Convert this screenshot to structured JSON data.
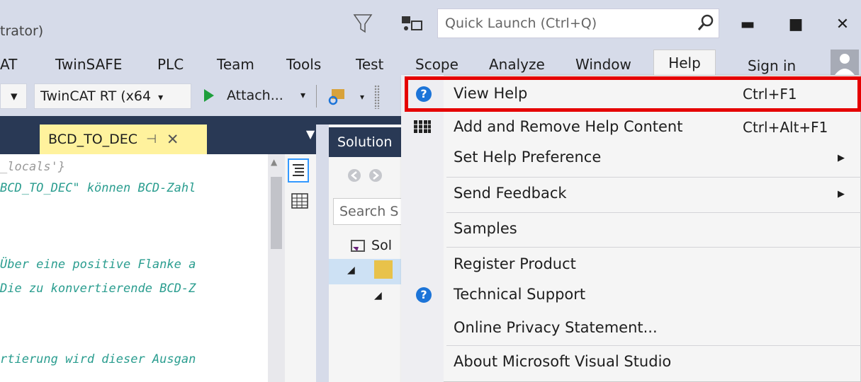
{
  "window": {
    "title": "trator)",
    "quick_launch_placeholder": "Quick Launch (Ctrl+Q)",
    "minimize": "▬",
    "maximize": "■",
    "close": "✕"
  },
  "menubar": {
    "items": [
      "AT",
      "TwinSAFE",
      "PLC",
      "Team",
      "Tools",
      "Test",
      "Scope",
      "Analyze",
      "Window",
      "Help"
    ],
    "sign_in": "Sign in"
  },
  "toolbar": {
    "dropdown_arrow": "▾",
    "target_combo": "TwinCAT RT (x64",
    "attach": "Attach...",
    "attach_arrow": "▾"
  },
  "editor": {
    "tab_label": "BCD_TO_DEC",
    "tab_pin": "⊣",
    "tab_close": "✕",
    "lines": [
      "_locals'}",
      "BCD_TO_DEC\" können BCD-Zahl",
      "",
      "Über eine positive Flanke a",
      "Die zu konvertierende BCD-Z",
      "",
      "rtierung wird dieser Ausgan"
    ]
  },
  "solution_explorer": {
    "title": "Solution",
    "search_placeholder": "Search S",
    "root_node": "Sol",
    "expander": "◢"
  },
  "help_menu": {
    "items": [
      {
        "label": "View Help",
        "shortcut": "Ctrl+F1",
        "icon": "question-icon",
        "submenu": false
      },
      {
        "label": "Add and Remove Help Content",
        "shortcut": "Ctrl+Alt+F1",
        "icon": "library-icon",
        "submenu": false
      },
      {
        "label": "Set Help Preference",
        "shortcut": "",
        "icon": "",
        "submenu": true
      },
      {
        "label": "Send Feedback",
        "shortcut": "",
        "icon": "",
        "submenu": true
      },
      {
        "label": "Samples",
        "shortcut": "",
        "icon": "",
        "submenu": false
      },
      {
        "label": "Register Product",
        "shortcut": "",
        "icon": "",
        "submenu": false
      },
      {
        "label": "Technical Support",
        "shortcut": "",
        "icon": "question-icon",
        "submenu": false
      },
      {
        "label": "Online Privacy Statement...",
        "shortcut": "",
        "icon": "",
        "submenu": false
      },
      {
        "label": "About Microsoft Visual Studio",
        "shortcut": "",
        "icon": "",
        "submenu": false
      }
    ],
    "submenu_arrow": "▶",
    "highlight_color": "#e50000"
  },
  "colors": {
    "chrome": "#d6dbe9",
    "dark_panel": "#293955",
    "active_tab": "#fff29d",
    "code_comment": "#2a9d8f"
  }
}
